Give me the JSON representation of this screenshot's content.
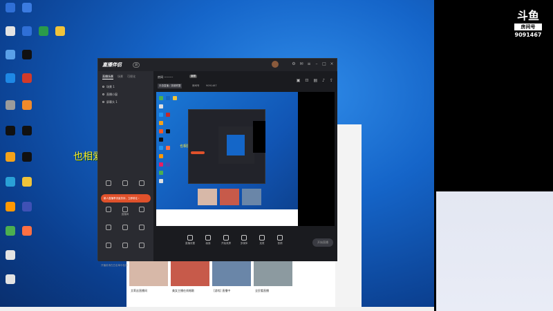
{
  "desktop": {
    "overlay_text": "也相爱着",
    "icon_colors": [
      "#2f6fd6",
      "#e3e3e3",
      "#2a9b4a",
      "#f0c33a",
      "#3b7be0",
      "#9b9b9b",
      "#d23a2a",
      "#5aa0e8",
      "#f08a2a",
      "#111111",
      "#e3502a",
      "#7a5cd2",
      "#2aa0d6",
      "#f4a21a",
      "#1e88e5",
      "#c62828",
      "#4caf50",
      "#ff9800",
      "#e91e63",
      "#3f51b5",
      "#ffffff",
      "#2196f3",
      "#ff7043",
      "#ff5722",
      "#1565c0",
      "#e0e0e0"
    ]
  },
  "app": {
    "logo": "直播伴侣",
    "version_badge": "测",
    "left_tabs": [
      "直播场景",
      "场景",
      "可视化"
    ],
    "scenes": [
      "场景 1",
      "直播小窗",
      "屏幕头 1"
    ],
    "grid_items": [
      "",
      "",
      "",
      "",
      "直播间",
      "",
      "",
      "",
      "",
      "",
      "",
      ""
    ],
    "promo_text": "新人直播享流量扶持，立即前往 ›",
    "status_text": "开播前请在白名单中检测",
    "room": {
      "title": "房间 ---------",
      "edit_label": "编辑",
      "category_label": "手游直播 / 英雄联盟",
      "id_label": "房间号",
      "id_value": "9091467"
    },
    "bottom_items": [
      "直播设置",
      "画面",
      "开始录屏",
      "多媒体",
      "连麦",
      "音频"
    ],
    "start_button": "开始直播"
  },
  "preview": {
    "overlay_text": "也相爱着"
  },
  "douyu": {
    "logo_text": "斗鱼",
    "room_label": "房间号",
    "room_number": "9091467"
  },
  "bg_window": {
    "thumb_captions": [
      "艾莉丝直播间",
      "美女主播在线唱歌",
      "[游戏] 直播中",
      "全民看直播"
    ]
  }
}
